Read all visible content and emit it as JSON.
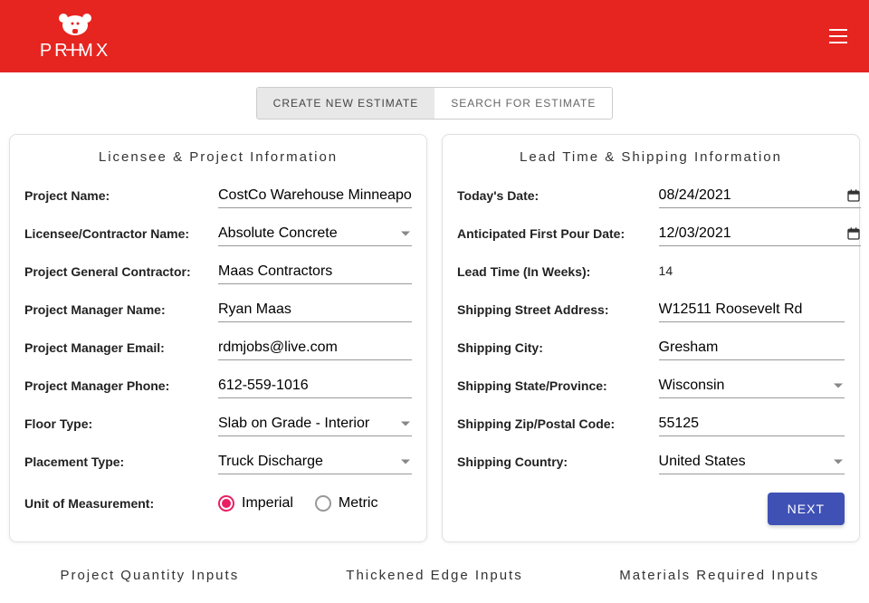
{
  "header": {
    "brand": "PRIMX"
  },
  "tabs": {
    "create": "CREATE NEW ESTIMATE",
    "search": "SEARCH FOR ESTIMATE"
  },
  "left": {
    "title": "Licensee & Project Information",
    "project_name_label": "Project Name:",
    "project_name_value": "CostCo Warehouse Minneapolis",
    "licensee_label": "Licensee/Contractor Name:",
    "licensee_value": "Absolute Concrete",
    "gc_label": "Project General Contractor:",
    "gc_value": "Maas Contractors",
    "pm_name_label": "Project Manager Name:",
    "pm_name_value": "Ryan Maas",
    "pm_email_label": "Project Manager Email:",
    "pm_email_value": "rdmjobs@live.com",
    "pm_phone_label": "Project Manager Phone:",
    "pm_phone_value": "612-559-1016",
    "floor_label": "Floor Type:",
    "floor_value": "Slab on Grade - Interior",
    "placement_label": "Placement Type:",
    "placement_value": "Truck Discharge",
    "unit_label": "Unit of Measurement:",
    "unit_imperial": "Imperial",
    "unit_metric": "Metric"
  },
  "right": {
    "title": "Lead Time & Shipping Information",
    "today_label": "Today's Date:",
    "today_value": "08/24/2021",
    "pour_label": "Anticipated First Pour Date:",
    "pour_value": "12/03/2021",
    "lead_label": "Lead Time (In Weeks):",
    "lead_value": "14",
    "street_label": "Shipping Street Address:",
    "street_value": "W12511 Roosevelt Rd",
    "city_label": "Shipping City:",
    "city_value": "Gresham",
    "state_label": "Shipping State/Province:",
    "state_value": "Wisconsin",
    "zip_label": "Shipping Zip/Postal Code:",
    "zip_value": "55125",
    "country_label": "Shipping Country:",
    "country_value": "United States",
    "next": "NEXT"
  },
  "bottom": {
    "qty": "Project Quantity Inputs",
    "edge": "Thickened Edge Inputs",
    "materials": "Materials Required Inputs"
  }
}
